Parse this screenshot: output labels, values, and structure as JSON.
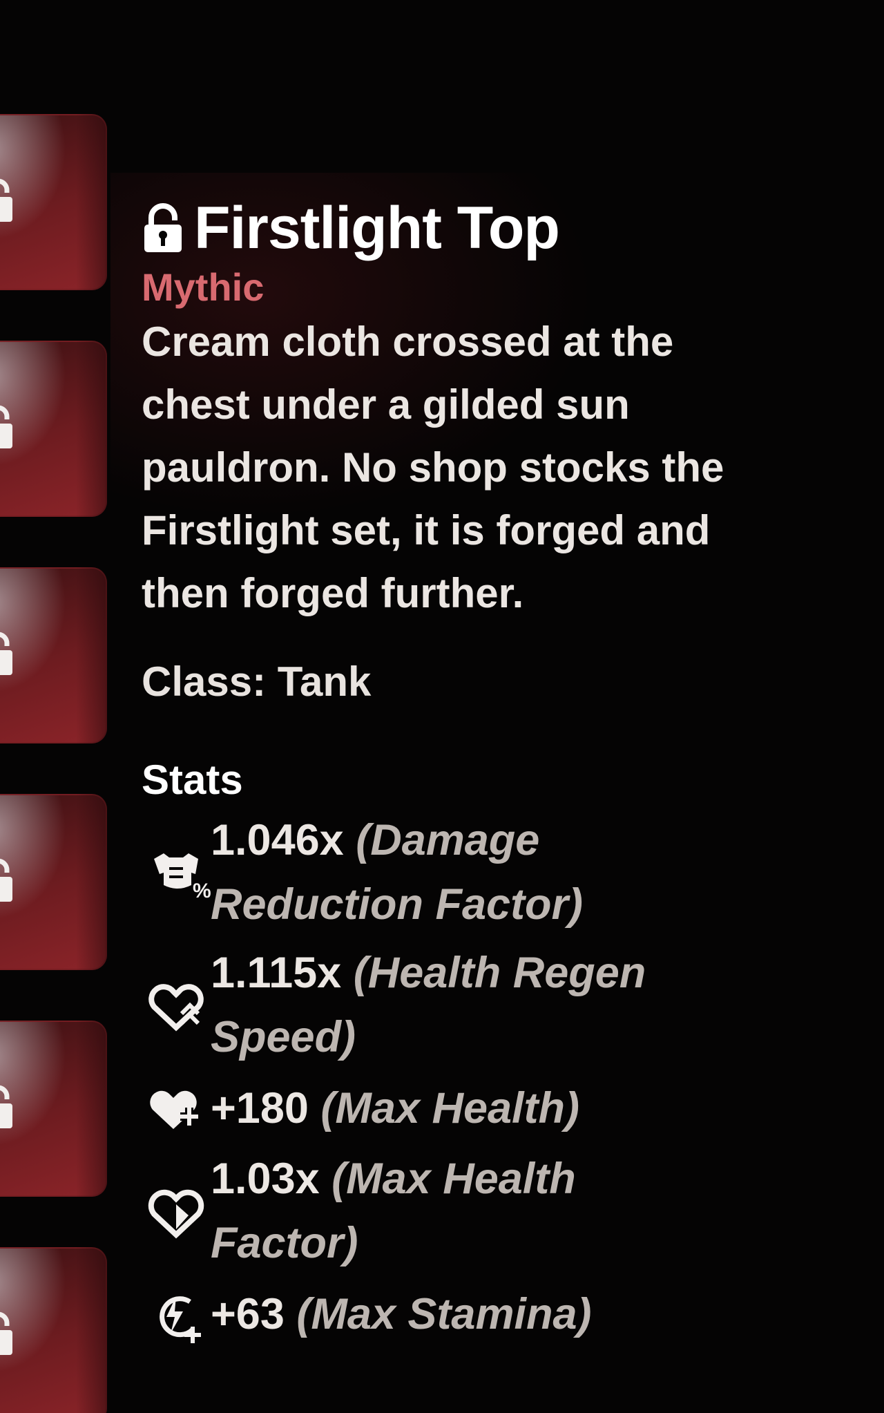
{
  "slots": [
    {
      "icon": "lock-icon"
    },
    {
      "icon": "lock-icon"
    },
    {
      "icon": "lock-icon"
    },
    {
      "icon": "lock-icon"
    },
    {
      "icon": "lock-icon"
    },
    {
      "icon": "lock-icon"
    }
  ],
  "item": {
    "icon": "lock-icon",
    "name": "Firstlight Top",
    "rarity": "Mythic",
    "rarity_color": "#d86a70",
    "description": "Cream cloth crossed at the chest under a gilded sun pauldron. No shop stocks the Firstlight set, it is forged and then forged further.",
    "class_line": "Class: Tank"
  },
  "stats_heading": "Stats",
  "stats": [
    {
      "icon": "damage-reduction-icon",
      "value": "1.046x",
      "label": "(Damage Reduction Factor)"
    },
    {
      "icon": "health-regen-icon",
      "value": "1.115x",
      "label": "(Health Regen Speed)"
    },
    {
      "icon": "max-health-plus-icon",
      "value": "+180",
      "label": "(Max Health)"
    },
    {
      "icon": "heart-icon",
      "value": "1.03x",
      "label": "(Max Health Factor)"
    },
    {
      "icon": "stamina-plus-icon",
      "value": "+63",
      "label": "(Max Stamina)"
    }
  ]
}
